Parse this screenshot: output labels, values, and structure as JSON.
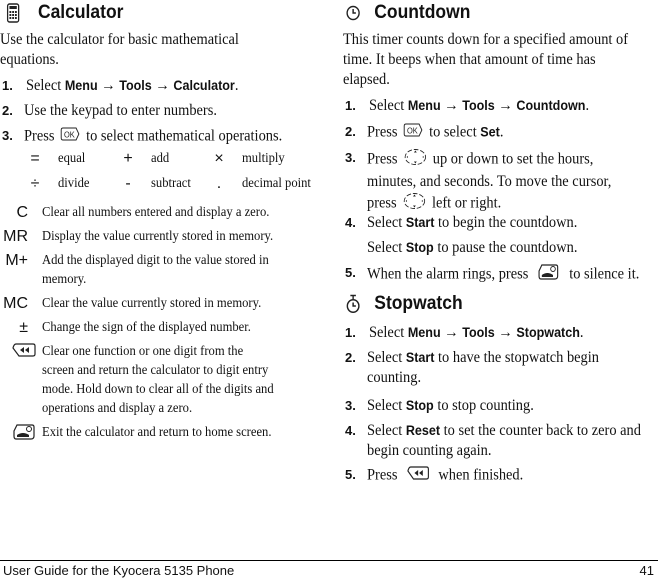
{
  "calculator": {
    "title": "Calculator",
    "icon": "calculator-icon",
    "intro": [
      "Use the calculator for basic mathematical",
      "equations."
    ],
    "steps": [
      {
        "num": "1.",
        "pre": "Select ",
        "menu": "Menu",
        "arrow1": " → ",
        "tools": "Tools",
        "arrow2": " → ",
        "item": "Calculator",
        "post": "."
      },
      {
        "num": "2.",
        "text": "Use the keypad to enter numbers."
      },
      {
        "num": "3.",
        "pre": "Press",
        "key": "ok-key-icon",
        "post": "to select mathematical operations."
      }
    ],
    "operators": [
      {
        "symbol": "=",
        "label": "equal"
      },
      {
        "symbol": "+",
        "label": "add"
      },
      {
        "symbol": "×",
        "label": "multiply"
      },
      {
        "symbol": "÷",
        "label": "divide"
      },
      {
        "symbol": "-",
        "label": "subtract"
      },
      {
        "symbol": ".",
        "label": "decimal point"
      }
    ],
    "functions": [
      {
        "symbol": "C",
        "lines": [
          "Clear all numbers entered and display a zero."
        ]
      },
      {
        "symbol": "MR",
        "lines": [
          "Display the value currently stored in memory."
        ]
      },
      {
        "symbol": "M+",
        "lines": [
          "Add the displayed digit to the value stored in",
          "memory."
        ]
      },
      {
        "symbol": "MC",
        "lines": [
          "Clear the value currently stored in memory."
        ]
      },
      {
        "symbol": "±",
        "lines": [
          "Change the sign of the displayed number."
        ]
      },
      {
        "icon": "back-key-icon",
        "lines": [
          "Clear one function or one digit from the",
          "screen and return the calculator to digit entry",
          "mode. Hold down to clear all of the digits and",
          "operations and display a zero."
        ]
      },
      {
        "icon": "end-key-icon",
        "lines": [
          "Exit the calculator and return to home screen."
        ]
      }
    ]
  },
  "countdown": {
    "title": "Countdown",
    "icon": "clock-icon",
    "intro": [
      "This timer counts down for a specified amount of",
      "time. It beeps when that amount of time has",
      "elapsed."
    ],
    "steps": [
      {
        "num": "1.",
        "pre": "Select ",
        "menu": "Menu",
        "arrow1": " → ",
        "tools": "Tools",
        "arrow2": " → ",
        "item": "Countdown",
        "post": "."
      },
      {
        "num": "2.",
        "pre": "Press",
        "post": "to select ",
        "bold": "Set",
        "end": "."
      },
      {
        "num": "3.",
        "pre": "Press",
        "post": "up or down to set the hours,",
        "line2": "minutes, and seconds. To move the cursor,",
        "line3pre": "press",
        "line3post": "left or right."
      },
      {
        "num": "4.",
        "pre": "Select ",
        "bold": "Start",
        "post": " to begin the countdown.",
        "sub_pre": "Select ",
        "sub_bold": "Stop",
        "sub_post": " to pause the countdown."
      },
      {
        "num": "5.",
        "pre": "When the alarm rings, press",
        "post": "to silence it."
      }
    ]
  },
  "stopwatch": {
    "title": "Stopwatch",
    "icon": "stopwatch-icon",
    "steps": [
      {
        "num": "1.",
        "pre": "Select ",
        "menu": "Menu",
        "arrow1": " → ",
        "tools": "Tools",
        "arrow2": " → ",
        "item": "Stopwatch",
        "post": "."
      },
      {
        "num": "2.",
        "pre": "Select ",
        "bold": "Start",
        "post": " to have the stopwatch begin",
        "line2": "counting."
      },
      {
        "num": "3.",
        "pre": "Select ",
        "bold": "Stop",
        "post": " to stop counting."
      },
      {
        "num": "4.",
        "pre": "Select ",
        "bold": "Reset",
        "post": " to set the counter back to zero and",
        "line2": "begin counting again."
      },
      {
        "num": "5.",
        "pre": "Press",
        "post": "when finished."
      }
    ]
  },
  "footer": {
    "left": "User Guide for the Kyocera 5135 Phone",
    "page": "41"
  }
}
